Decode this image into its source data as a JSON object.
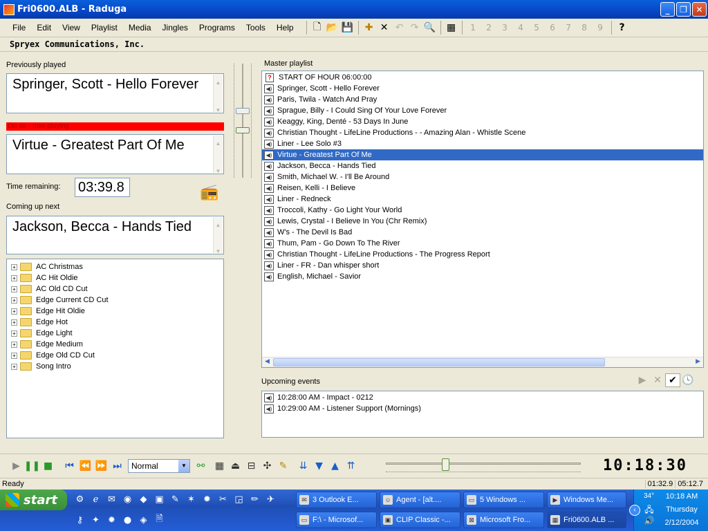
{
  "window": {
    "title": "Fri0600.ALB - Raduga",
    "min": "_",
    "max": "❐",
    "close": "✕"
  },
  "menu": [
    "File",
    "Edit",
    "View",
    "Playlist",
    "Media",
    "Jingles",
    "Programs",
    "Tools",
    "Help"
  ],
  "toolbar": {
    "numbers": [
      "1",
      "2",
      "3",
      "4",
      "5",
      "6",
      "7",
      "8",
      "9"
    ]
  },
  "company": "Spryex Communications, Inc.",
  "previous": {
    "label": "Previously played",
    "text": "Springer, Scott - Hello Forever"
  },
  "onair": {
    "label": "On air - now playing",
    "text": "Virtue - Greatest Part Of Me"
  },
  "time": {
    "label": "Time remaining:",
    "value": "03:39.8"
  },
  "next": {
    "label": "Coming up next",
    "text": "Jackson, Becca - Hands Tied"
  },
  "tree": [
    "AC Christmas",
    "AC Hit Oldie",
    "AC Old CD Cut",
    "Edge Current CD Cut",
    "Edge Hit Oldie",
    "Edge Hot",
    "Edge Light",
    "Edge Medium",
    "Edge Old CD Cut",
    "Song Intro"
  ],
  "master": {
    "label": "Master playlist",
    "items": [
      "START OF HOUR 06:00:00",
      "Springer, Scott - Hello Forever",
      "Paris, Twila - Watch And Pray",
      "Sprague, Billy - I Could Sing Of Your Love Forever",
      "Keaggy, King, Denté - 53 Days In June",
      "Christian Thought - LifeLine Productions -  - Amazing Alan - Whistle Scene",
      "Liner - Lee Solo #3",
      "Virtue - Greatest Part Of Me",
      "Jackson, Becca - Hands Tied",
      "Smith, Michael W. - I'll Be Around",
      "Reisen, Kelli - I Believe",
      "Liner - Redneck",
      "Troccoli, Kathy - Go Light Your World",
      "Lewis, Crystal - I Believe In You (Chr Remix)",
      "W's - The Devil Is Bad",
      "Thum, Pam - Go Down To The River",
      "Christian Thought - LifeLine Productions -  The Progress Report",
      "Liner - FR - Dan whisper short",
      "English, Michael - Savior"
    ]
  },
  "upcoming": {
    "label": "Upcoming events",
    "items": [
      "10:28:00 AM  -  Impact - 0212",
      "10:29:00 AM  -  Listener Support (Mornings)"
    ]
  },
  "transport": {
    "mode": "Normal",
    "clock": "10:18:30",
    "seek_fraction": 0.3
  },
  "status": {
    "text": "Ready",
    "elapsed": "01:32.9",
    "total": "05:12.7"
  },
  "taskbar": {
    "start": "start",
    "row1": [
      "3 Outlook E...",
      "Agent - [alt....",
      "5 Windows ...",
      "Windows Me..."
    ],
    "row2": [
      "F:\\ - Microsof...",
      "CLIP Classic -...",
      "Microsoft Fro...",
      "Fri0600.ALB ..."
    ],
    "temp": "34°",
    "time": "10:18 AM",
    "day": "Thursday",
    "date": "2/12/2004"
  }
}
